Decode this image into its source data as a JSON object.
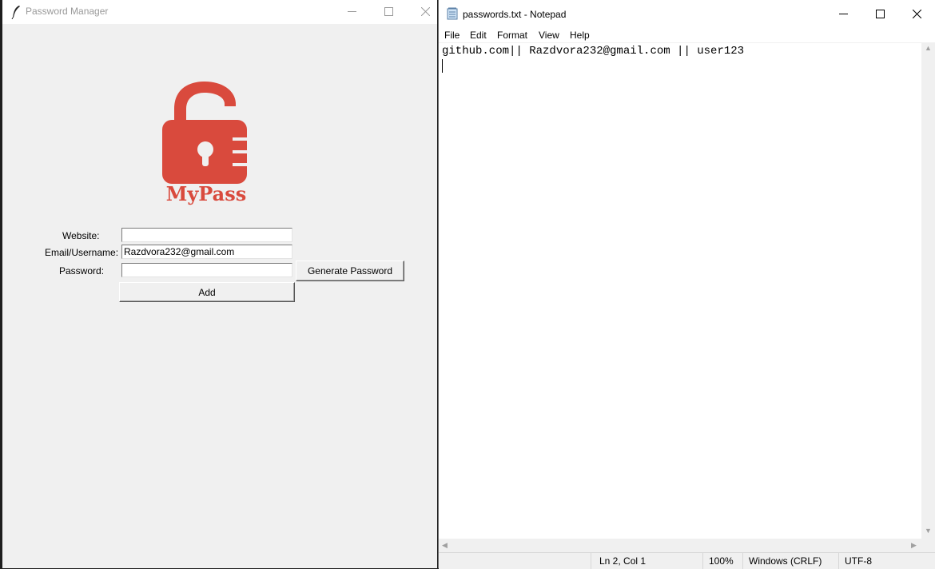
{
  "password_manager": {
    "window_title": "Password Manager",
    "logo_text": "MyPass",
    "labels": {
      "website": "Website:",
      "email": "Email/Username:",
      "password": "Password:"
    },
    "fields": {
      "website": "",
      "email": "Razdvora232@gmail.com",
      "password": ""
    },
    "buttons": {
      "generate": "Generate Password",
      "add": "Add"
    },
    "logo_color": "#d94a3d"
  },
  "notepad": {
    "window_title": "passwords.txt - Notepad",
    "menu": [
      "File",
      "Edit",
      "Format",
      "View",
      "Help"
    ],
    "lines": [
      "github.com|| Razdvora232@gmail.com || user123"
    ],
    "status": {
      "position": "Ln 2, Col 1",
      "zoom": "100%",
      "line_ending": "Windows (CRLF)",
      "encoding": "UTF-8"
    }
  }
}
